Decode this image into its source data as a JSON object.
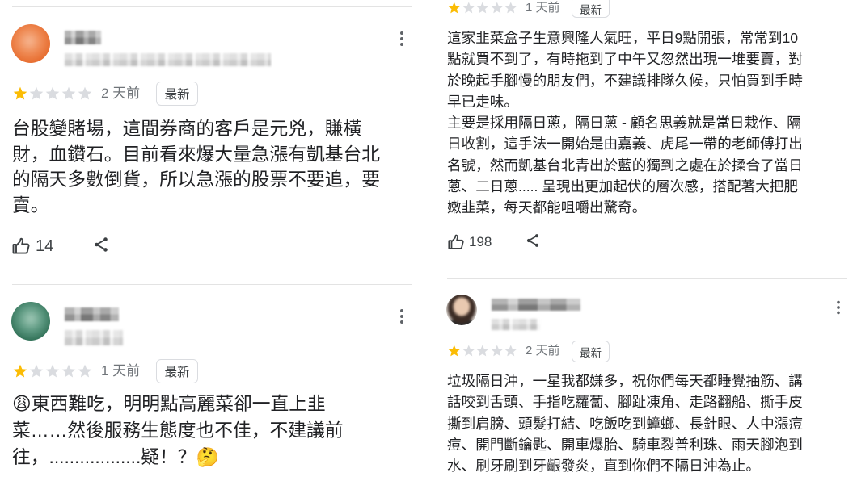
{
  "colors": {
    "star_filled": "#fbbc04",
    "star_empty": "#dadce0",
    "text_primary": "#202124",
    "text_secondary": "#70757a",
    "icon": "#3c4043",
    "divider": "#e3e3e3"
  },
  "icons": {
    "rating": "star-icon",
    "like": "thumb-up-icon",
    "share": "share-icon",
    "more": "more-vert-icon"
  },
  "columns": [
    {
      "reviews": [
        {
          "rating": 1,
          "max_rating": 5,
          "time": "2 天前",
          "badge": "最新",
          "body": [
            "台股變賭場，這間券商的客戶是元兇，賺橫",
            "財，血鑽石。目前看來爆大量急漲有凱基台北",
            "的隔天多數倒貨，所以急漲的股票不要追，要",
            "賣。"
          ],
          "likes": "14"
        },
        {
          "rating": 1,
          "max_rating": 5,
          "time": "1 天前",
          "badge": "最新",
          "body": [
            "😩東西難吃，明明點高麗菜卻一直上韭",
            "菜……然後服務生態度也不佳，不建議前",
            "往，..................疑！？🤔"
          ]
        }
      ]
    },
    {
      "reviews": [
        {
          "rating": 1,
          "max_rating": 5,
          "time": "1 天前",
          "badge": "最新",
          "body": [
            "這家韭菜盒子生意興隆人氣旺，平日9點開張，常常到10",
            "點就買不到了，有時拖到了中午又忽然出現一堆要賣，對",
            "於晚起手腳慢的朋友們，不建議排隊久候，只怕買到手時",
            "早已走味。",
            "主要是採用隔日蔥，隔日蔥 - 顧名思義就是當日栽作、隔",
            "日收割，這手法一開始是由嘉義、虎尾一帶的老師傅打出",
            "名號，然而凱基台北青出於藍的獨到之處在於揉合了當日",
            "蔥、二日蔥..... 呈現出更加起伏的層次感，搭配著大把肥",
            "嫩韭菜，每天都能咀嚼出驚奇。"
          ],
          "likes": "198"
        },
        {
          "rating": 1,
          "max_rating": 5,
          "time": "2 天前",
          "badge": "最新",
          "body": [
            "垃圾隔日沖，一星我都嫌多，祝你們每天都睡覺抽筋、講",
            "話咬到舌頭、手指吃蘿蔔、腳趾凍角、走路翻船、撕手皮",
            "撕到肩膀、頭髮打結、吃飯吃到蟑螂、長針眼、人中漲痘",
            "痘、開門斷鑰匙、開車爆胎、騎車裂普利珠、雨天腳泡到",
            "水、刷牙刷到牙齦發炎，直到你們不隔日沖為止。"
          ]
        }
      ]
    }
  ]
}
